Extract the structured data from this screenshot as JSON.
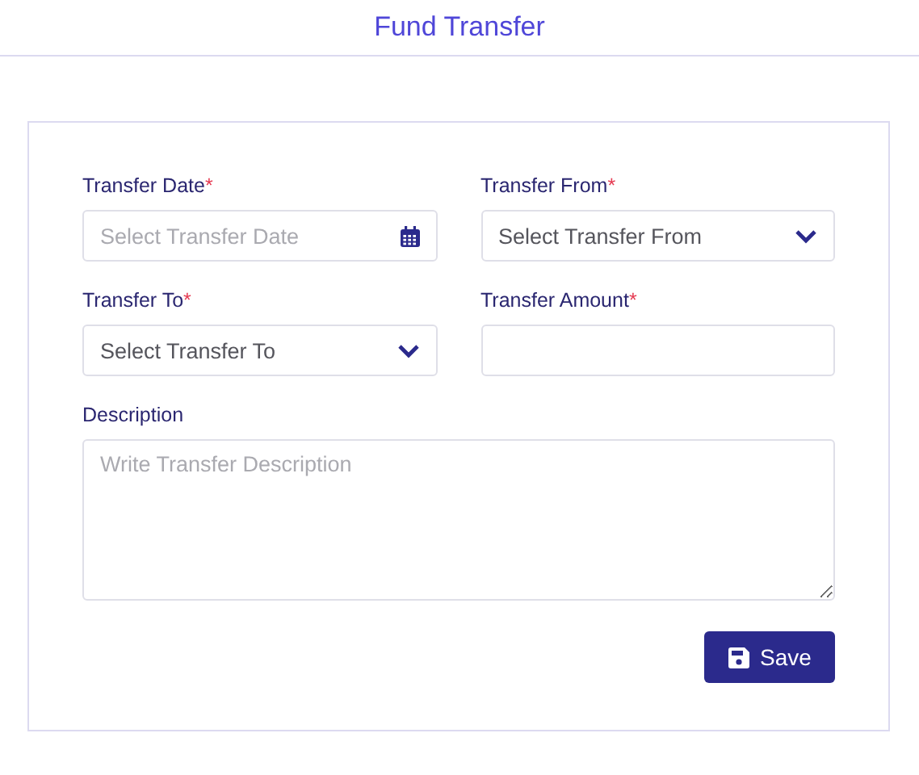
{
  "header": {
    "title": "Fund Transfer"
  },
  "fields": [
    {
      "kind": "date",
      "label": "Transfer Date",
      "required_mark": "*",
      "placeholder": "Select Transfer Date"
    },
    {
      "kind": "select",
      "label": "Transfer From",
      "required_mark": "*",
      "placeholder": "Select Transfer From"
    },
    {
      "kind": "select",
      "label": "Transfer To",
      "required_mark": "*",
      "placeholder": "Select Transfer To"
    },
    {
      "kind": "text",
      "label": "Transfer Amount",
      "required_mark": "*"
    },
    {
      "kind": "textarea",
      "label": "Description",
      "placeholder": "Write Transfer Description"
    }
  ],
  "save_button": {
    "label": "Save"
  }
}
